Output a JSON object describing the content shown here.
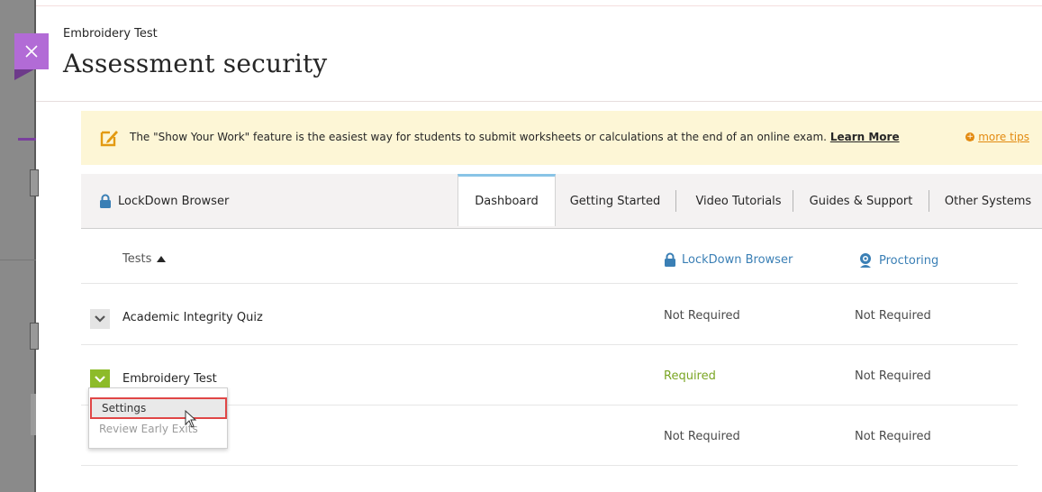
{
  "header": {
    "breadcrumb": "Embroidery Test",
    "title": "Assessment security"
  },
  "tips": {
    "text": "The \"Show Your Work\" feature is the easiest way for students to submit worksheets or calculations at the end of an online exam.",
    "link": "Learn More",
    "more": "more tips"
  },
  "brand": "LockDown Browser",
  "tabs": [
    {
      "label": "Dashboard",
      "active": true
    },
    {
      "label": "Getting Started"
    },
    {
      "label": "Video Tutorials"
    },
    {
      "label": "Guides & Support"
    },
    {
      "label": "Other Systems"
    }
  ],
  "table": {
    "headers": {
      "tests": "Tests",
      "lockdown": "LockDown Browser",
      "proctoring": "Proctoring"
    },
    "rows": [
      {
        "name": "Academic Integrity Quiz",
        "lockdown": "Not Required",
        "proctoring": "Not Required"
      },
      {
        "name": "Embroidery Test",
        "lockdown": "Required",
        "proctoring": "Not Required"
      },
      {
        "name": "",
        "lockdown": "Not Required",
        "proctoring": "Not Required"
      }
    ]
  },
  "menu": {
    "items": [
      "Settings",
      "Review Early Exits"
    ]
  },
  "colors": {
    "close_button": "#b26bd6",
    "required": "#7aa523",
    "link_blue": "#3a7fb5",
    "tips_orange": "#e38a10",
    "banner_bg": "#fdf6d6"
  }
}
